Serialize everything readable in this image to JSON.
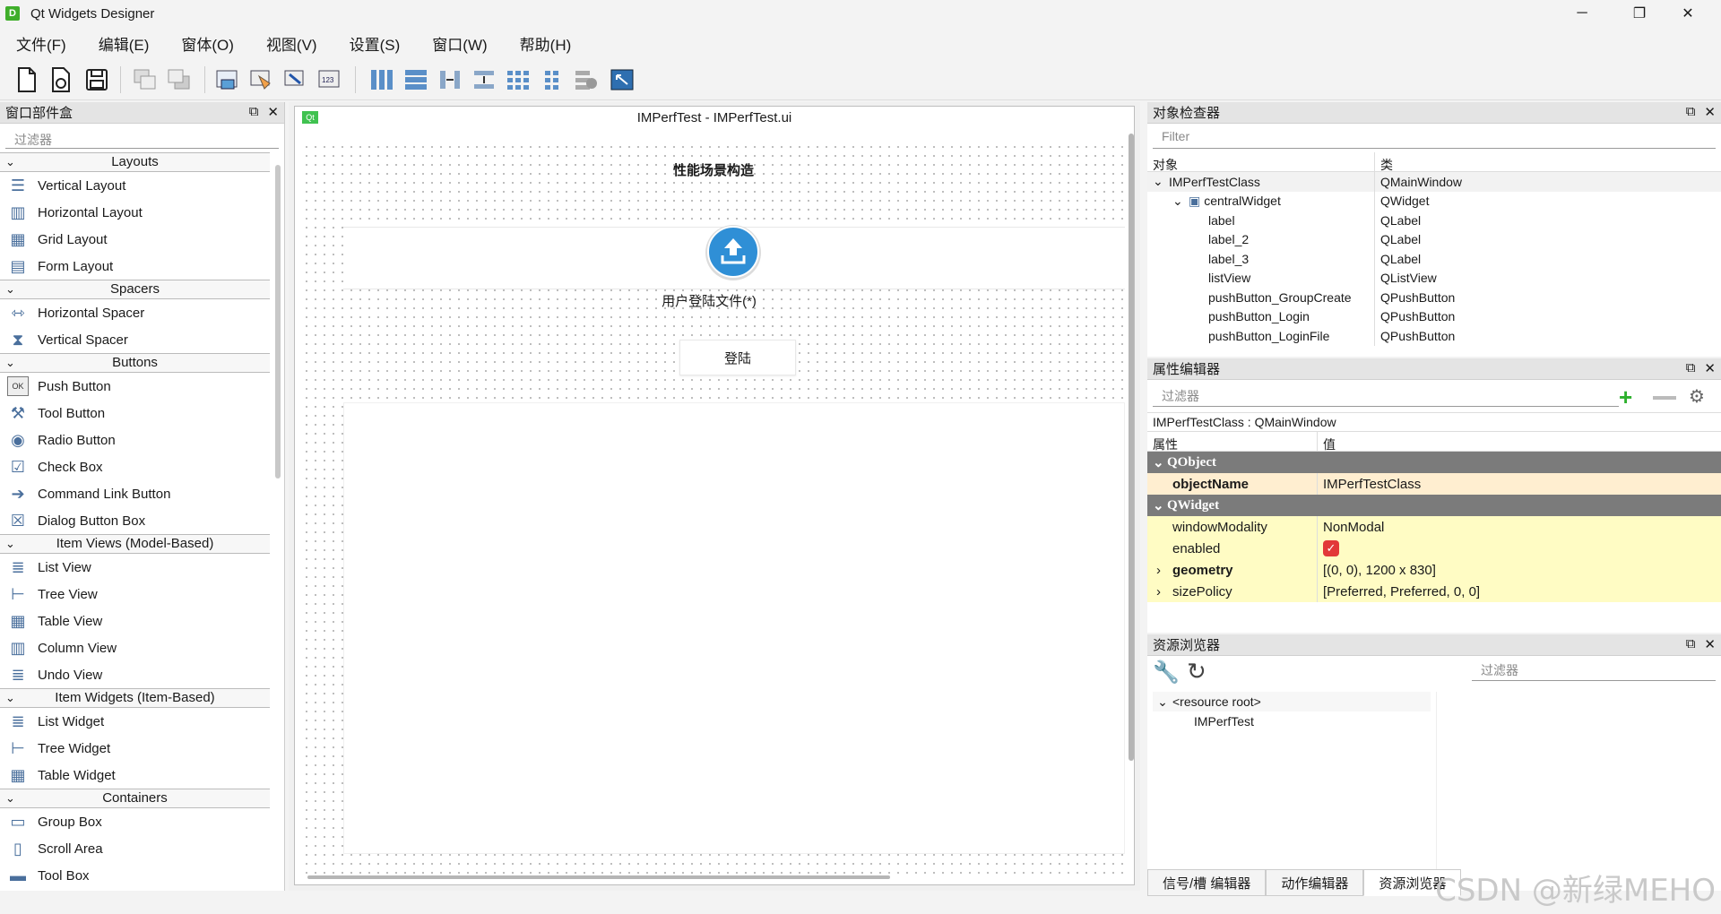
{
  "window": {
    "title": "Qt Widgets Designer",
    "icon_letter": "D",
    "controls": {
      "minimize": "─",
      "maximize": "❐",
      "close": "✕"
    }
  },
  "menubar": [
    "文件(F)",
    "编辑(E)",
    "窗体(O)",
    "视图(V)",
    "设置(S)",
    "窗口(W)",
    "帮助(H)"
  ],
  "widget_box": {
    "title": "窗口部件盒",
    "filter_placeholder": "过滤器",
    "categories": [
      {
        "name": "Layouts",
        "items": [
          {
            "label": "Vertical Layout",
            "icon": "vertical-layout-icon"
          },
          {
            "label": "Horizontal Layout",
            "icon": "horizontal-layout-icon"
          },
          {
            "label": "Grid Layout",
            "icon": "grid-layout-icon"
          },
          {
            "label": "Form Layout",
            "icon": "form-layout-icon"
          }
        ]
      },
      {
        "name": "Spacers",
        "items": [
          {
            "label": "Horizontal Spacer",
            "icon": "horizontal-spacer-icon"
          },
          {
            "label": "Vertical Spacer",
            "icon": "vertical-spacer-icon"
          }
        ]
      },
      {
        "name": "Buttons",
        "items": [
          {
            "label": "Push Button",
            "icon": "push-button-icon"
          },
          {
            "label": "Tool Button",
            "icon": "tool-button-icon"
          },
          {
            "label": "Radio Button",
            "icon": "radio-button-icon"
          },
          {
            "label": "Check Box",
            "icon": "check-box-icon"
          },
          {
            "label": "Command Link Button",
            "icon": "command-link-icon"
          },
          {
            "label": "Dialog Button Box",
            "icon": "dialog-button-box-icon"
          }
        ]
      },
      {
        "name": "Item Views (Model-Based)",
        "items": [
          {
            "label": "List View",
            "icon": "list-view-icon"
          },
          {
            "label": "Tree View",
            "icon": "tree-view-icon"
          },
          {
            "label": "Table View",
            "icon": "table-view-icon"
          },
          {
            "label": "Column View",
            "icon": "column-view-icon"
          },
          {
            "label": "Undo View",
            "icon": "undo-view-icon"
          }
        ]
      },
      {
        "name": "Item Widgets (Item-Based)",
        "items": [
          {
            "label": "List Widget",
            "icon": "list-widget-icon"
          },
          {
            "label": "Tree Widget",
            "icon": "tree-widget-icon"
          },
          {
            "label": "Table Widget",
            "icon": "table-widget-icon"
          }
        ]
      },
      {
        "name": "Containers",
        "items": [
          {
            "label": "Group Box",
            "icon": "group-box-icon"
          },
          {
            "label": "Scroll Area",
            "icon": "scroll-area-icon"
          },
          {
            "label": "Tool Box",
            "icon": "tool-box-icon"
          }
        ]
      }
    ]
  },
  "form": {
    "qt_badge": "Qt",
    "title": "IMPerfTest - IMPerfTest.ui",
    "heading": "性能场景构造",
    "upload_label": "用户登陆文件(*)",
    "login_button": "登陆"
  },
  "object_inspector": {
    "title": "对象检查器",
    "filter_placeholder": "Filter",
    "col_object": "对象",
    "col_class": "类",
    "rows": [
      {
        "name": "IMPerfTestClass",
        "cls": "QMainWindow",
        "indent": 0,
        "expand": "⌄"
      },
      {
        "name": "centralWidget",
        "cls": "QWidget",
        "indent": 1,
        "expand": "⌄"
      },
      {
        "name": "label",
        "cls": "QLabel",
        "indent": 2,
        "expand": ""
      },
      {
        "name": "label_2",
        "cls": "QLabel",
        "indent": 2,
        "expand": ""
      },
      {
        "name": "label_3",
        "cls": "QLabel",
        "indent": 2,
        "expand": ""
      },
      {
        "name": "listView",
        "cls": "QListView",
        "indent": 2,
        "expand": ""
      },
      {
        "name": "pushButton_GroupCreate",
        "cls": "QPushButton",
        "indent": 2,
        "expand": ""
      },
      {
        "name": "pushButton_Login",
        "cls": "QPushButton",
        "indent": 2,
        "expand": ""
      },
      {
        "name": "pushButton_LoginFile",
        "cls": "QPushButton",
        "indent": 2,
        "expand": ""
      }
    ]
  },
  "property_editor": {
    "title": "属性编辑器",
    "filter_placeholder": "过滤器",
    "context": "IMPerfTestClass : QMainWindow",
    "col_property": "属性",
    "col_value": "值",
    "rows": [
      {
        "type": "group",
        "name": "QObject"
      },
      {
        "type": "prop",
        "name": "objectName",
        "value": "IMPerfTestClass",
        "bold": true,
        "style": "orange",
        "expand": ""
      },
      {
        "type": "group",
        "name": "QWidget"
      },
      {
        "type": "prop",
        "name": "windowModality",
        "value": "NonModal",
        "bold": false,
        "style": "yellow",
        "expand": ""
      },
      {
        "type": "prop",
        "name": "enabled",
        "value": "",
        "checkbox": true,
        "bold": false,
        "style": "yellow",
        "expand": ""
      },
      {
        "type": "prop",
        "name": "geometry",
        "value": "[(0, 0), 1200 x 830]",
        "bold": true,
        "style": "yellow",
        "expand": "›"
      },
      {
        "type": "prop",
        "name": "sizePolicy",
        "value": "[Preferred, Preferred, 0, 0]",
        "bold": false,
        "style": "yellow",
        "expand": "›"
      }
    ]
  },
  "resource_browser": {
    "title": "资源浏览器",
    "filter_placeholder": "过滤器",
    "root": "<resource root>",
    "child": "IMPerfTest"
  },
  "bottom_tabs": [
    "信号/槽 编辑器",
    "动作编辑器",
    "资源浏览器"
  ],
  "watermark": "CSDN @新绿MEHO",
  "colors": {
    "group_header": "#7b7b7b",
    "prop_yellow": "#fffcc4",
    "prop_orange": "#ffeed0",
    "accent_blue": "#2f8fd6"
  }
}
